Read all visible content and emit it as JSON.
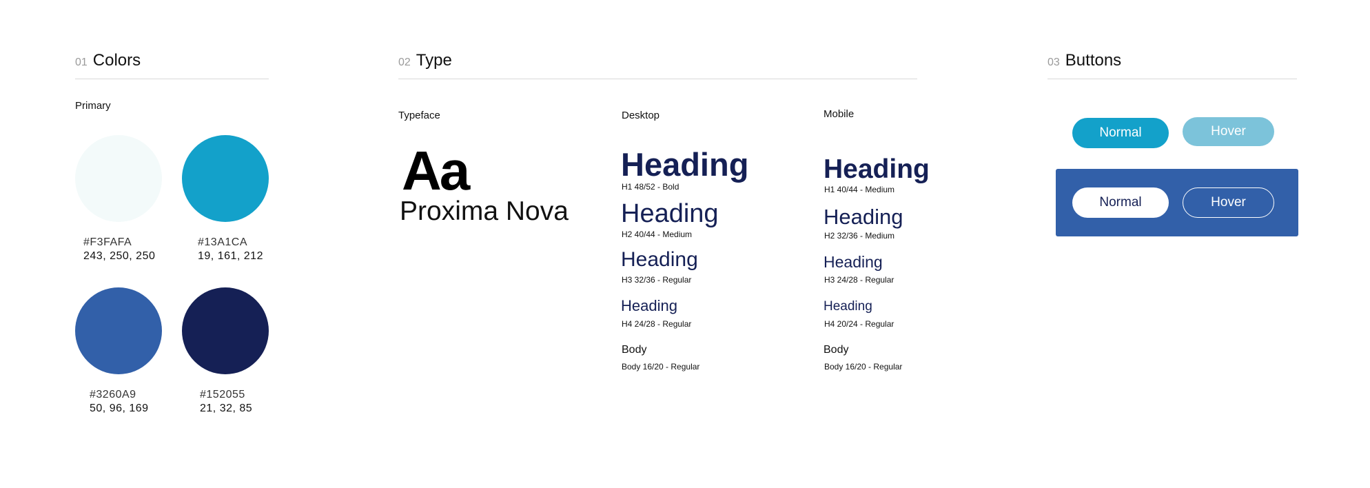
{
  "sections": {
    "colors": {
      "num": "01",
      "title": "Colors"
    },
    "type": {
      "num": "02",
      "title": "Type"
    },
    "buttons": {
      "num": "03",
      "title": "Buttons"
    }
  },
  "colors": {
    "group_label": "Primary",
    "swatches": [
      {
        "hex": "#F3FAFA",
        "rgb": "243, 250, 250"
      },
      {
        "hex": "#13A1CA",
        "rgb": "19, 161, 212"
      },
      {
        "hex": "#3260A9",
        "rgb": "50, 96, 169"
      },
      {
        "hex": "#152055",
        "rgb": "21, 32, 85"
      }
    ]
  },
  "type": {
    "typeface_label": "Typeface",
    "sample": "Aa",
    "family": "Proxima Nova",
    "desktop_label": "Desktop",
    "mobile_label": "Mobile",
    "desktop": [
      {
        "text": "Heading",
        "spec": "H1 48/52 - Bold"
      },
      {
        "text": "Heading",
        "spec": "H2 40/44 - Medium"
      },
      {
        "text": "Heading",
        "spec": "H3 32/36 - Regular"
      },
      {
        "text": "Heading",
        "spec": "H4 24/28 - Regular"
      },
      {
        "text": "Body",
        "spec": "Body 16/20 - Regular"
      }
    ],
    "mobile": [
      {
        "text": "Heading",
        "spec": "H1 40/44 - Medium"
      },
      {
        "text": "Heading",
        "spec": "H2 32/36 - Medium"
      },
      {
        "text": "Heading",
        "spec": "H3 24/28 - Regular"
      },
      {
        "text": "Heading",
        "spec": "H4 20/24 - Regular"
      },
      {
        "text": "Body",
        "spec": "Body 16/20 - Regular"
      }
    ],
    "heading_color": "#152055"
  },
  "buttons": {
    "light": {
      "normal": "Normal",
      "hover": "Hover",
      "normal_color": "#13A1CA",
      "hover_color": "#7CC3DA"
    },
    "dark": {
      "normal": "Normal",
      "hover": "Hover",
      "panel_color": "#3260A9"
    }
  }
}
